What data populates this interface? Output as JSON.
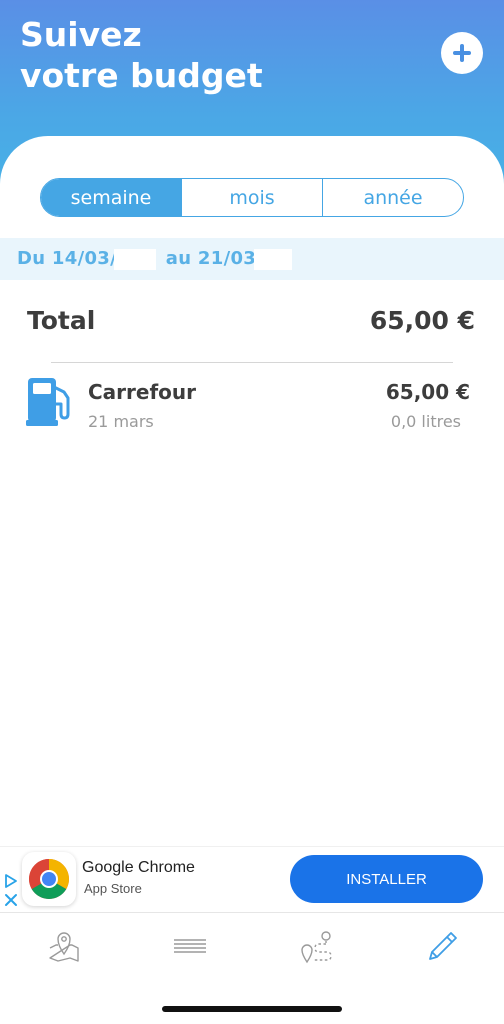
{
  "header": {
    "title_line1": "Suivez",
    "title_line2": "votre budget",
    "add_icon": "plus-icon",
    "gradient_top": "#5a8fe6",
    "gradient_bottom": "#47b1e6"
  },
  "period_selector": {
    "options": [
      "semaine",
      "mois",
      "année"
    ],
    "selected": "semaine",
    "accent": "#45a6e4"
  },
  "date_range": {
    "from_prefix": "Du 14/03/2",
    "to_prefix": "au 21/03/2"
  },
  "summary": {
    "total_label": "Total",
    "total_amount": "65,00 €"
  },
  "entries": [
    {
      "icon": "fuel-pump-icon",
      "name": "Carrefour",
      "date": "21 mars",
      "amount": "65,00 €",
      "volume": "0,0 litres"
    }
  ],
  "ad": {
    "app_name": "Google Chrome",
    "store": "App Store",
    "button_label": "INSTALLER",
    "button_color": "#1a73e8"
  },
  "tabbar": {
    "items": [
      "map-pin-icon",
      "list-icon",
      "route-icon",
      "pencil-icon"
    ],
    "active": "pencil-icon"
  }
}
